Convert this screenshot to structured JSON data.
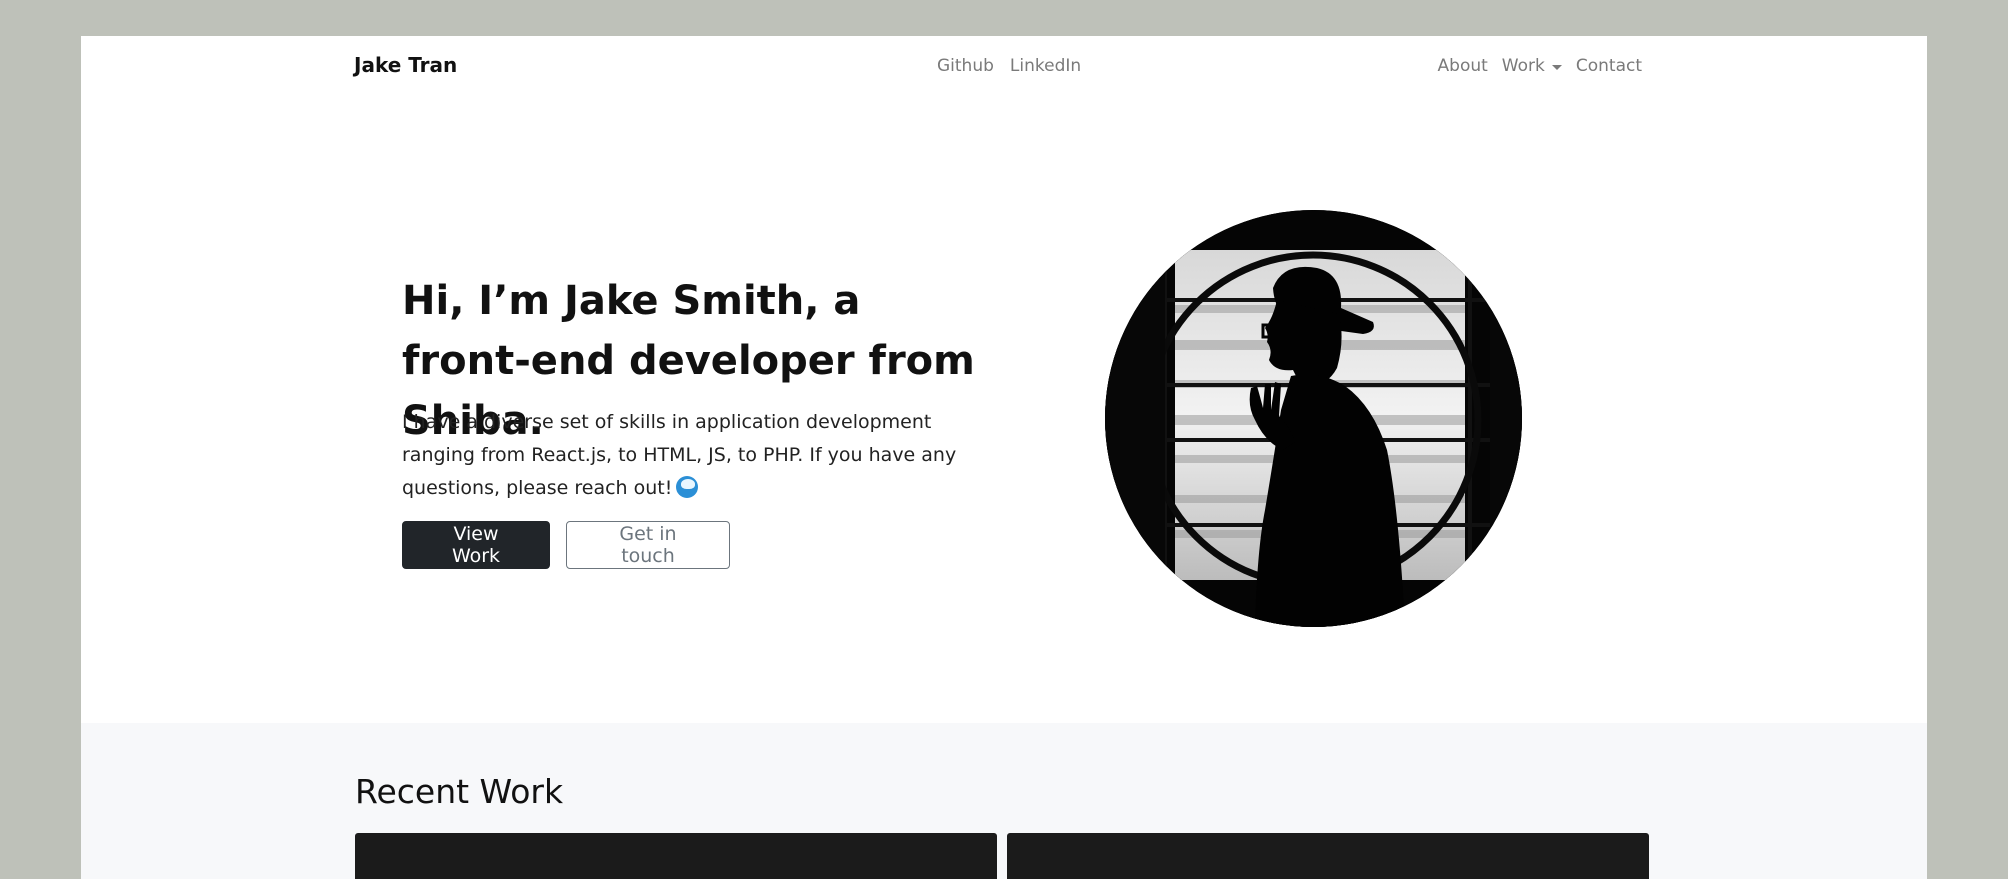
{
  "nav": {
    "brand": "Jake Tran",
    "center_links": [
      "Github",
      "LinkedIn"
    ],
    "right_links": {
      "about": "About",
      "work": "Work",
      "contact": "Contact"
    }
  },
  "hero": {
    "title": "Hi, I’m Jake Smith, a front-end developer from Shiba.",
    "text": "I have a diverse set of skills in application development ranging from React.js, to HTML, JS, to PHP. If you have any questions, please reach out!",
    "emoji_icon": "water-wave-icon",
    "primary_button": "View Work",
    "secondary_button": "Get in touch",
    "portrait_icon": "silhouette-portrait"
  },
  "recent_work": {
    "title": "Recent Work",
    "cards": [
      "work-card-1",
      "work-card-2"
    ]
  },
  "colors": {
    "outer_background": "#bec1b9",
    "page_background": "#ffffff",
    "section_background": "#f7f8fa",
    "primary_button": "#212529",
    "muted_text": "#6c757d",
    "card_background": "#1b1b1b"
  }
}
